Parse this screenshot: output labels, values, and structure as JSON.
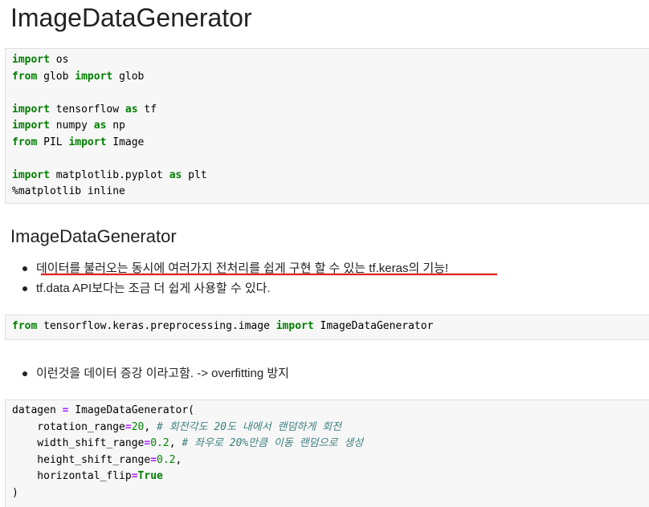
{
  "title": "ImageDataGenerator",
  "cell1": {
    "lines": [
      [
        [
          "kw",
          "import"
        ],
        [
          "t",
          " os"
        ]
      ],
      [
        [
          "kw",
          "from"
        ],
        [
          "t",
          " glob "
        ],
        [
          "kw",
          "import"
        ],
        [
          "t",
          " glob"
        ]
      ],
      [
        [
          "t",
          ""
        ]
      ],
      [
        [
          "kw",
          "import"
        ],
        [
          "t",
          " tensorflow "
        ],
        [
          "kw",
          "as"
        ],
        [
          "t",
          " tf"
        ]
      ],
      [
        [
          "kw",
          "import"
        ],
        [
          "t",
          " numpy "
        ],
        [
          "kw",
          "as"
        ],
        [
          "t",
          " np"
        ]
      ],
      [
        [
          "kw",
          "from"
        ],
        [
          "t",
          " PIL "
        ],
        [
          "kw",
          "import"
        ],
        [
          "t",
          " Image"
        ]
      ],
      [
        [
          "t",
          ""
        ]
      ],
      [
        [
          "kw",
          "import"
        ],
        [
          "t",
          " matplotlib.pyplot "
        ],
        [
          "kw",
          "as"
        ],
        [
          "t",
          " plt"
        ]
      ],
      [
        [
          "t",
          "%matplotlib inline"
        ]
      ]
    ]
  },
  "section_heading": "ImageDataGenerator",
  "bullets1": [
    "데이터를 불러오는 동시에 여러가지 전처리를 쉽게 구현 할 수 있는 tf.keras의 기능!",
    "tf.data API보다는 조금 더 쉽게 사용할 수 있다."
  ],
  "cell2": {
    "lines": [
      [
        [
          "kw",
          "from"
        ],
        [
          "t",
          " tensorflow.keras.preprocessing.image "
        ],
        [
          "kw",
          "import"
        ],
        [
          "t",
          " ImageDataGenerator"
        ]
      ]
    ]
  },
  "bullets2": [
    "이런것을 데이터 증강 이라고함. -> overfitting 방지"
  ],
  "cell3": {
    "lines": [
      [
        [
          "t",
          "datagen "
        ],
        [
          "op",
          "="
        ],
        [
          "t",
          " ImageDataGenerator("
        ]
      ],
      [
        [
          "t",
          "    rotation_range"
        ],
        [
          "op",
          "="
        ],
        [
          "num",
          "20"
        ],
        [
          "t",
          ", "
        ],
        [
          "cmt",
          "# 회전각도 20도 내에서 랜덤하게 회전"
        ]
      ],
      [
        [
          "t",
          "    width_shift_range"
        ],
        [
          "op",
          "="
        ],
        [
          "num",
          "0.2"
        ],
        [
          "t",
          ", "
        ],
        [
          "cmt",
          "# 좌우로 20%만큼 이동 랜덤으로 생성"
        ]
      ],
      [
        [
          "t",
          "    height_shift_range"
        ],
        [
          "op",
          "="
        ],
        [
          "num",
          "0.2"
        ],
        [
          "t",
          ","
        ]
      ],
      [
        [
          "t",
          "    horizontal_flip"
        ],
        [
          "op",
          "="
        ],
        [
          "kconst",
          "True"
        ]
      ],
      [
        [
          "t",
          ")"
        ]
      ]
    ]
  },
  "colors": {
    "keyword": "#008000",
    "operator": "#aa22ff",
    "number": "#008800",
    "comment": "#408080",
    "underline": "#e0201e",
    "cell_bg": "#f7f7f7"
  }
}
